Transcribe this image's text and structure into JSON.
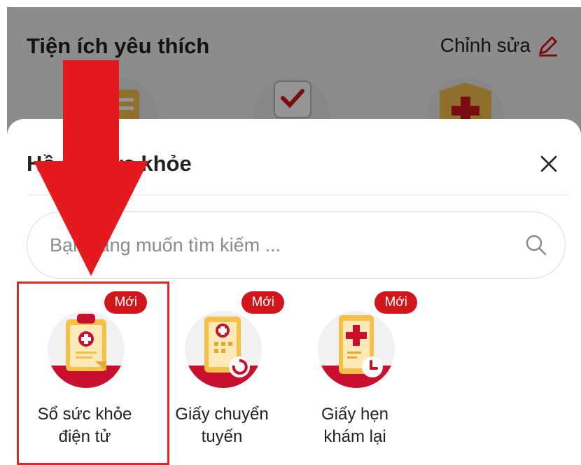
{
  "background": {
    "title": "Tiện ích yêu thích",
    "edit_label": "Chỉnh sửa",
    "edit_icon": "pencil-icon"
  },
  "sheet": {
    "title": "Hồ sơ sức khỏe",
    "close_icon": "close-icon",
    "search": {
      "placeholder": "Bạn đang muốn tìm kiếm ...",
      "value": "",
      "icon": "search-icon"
    },
    "items": [
      {
        "line1": "Sổ sức khỏe",
        "line2": "điện tử",
        "badge": "Mới",
        "icon": "health-record-clipboard-icon",
        "highlighted": true
      },
      {
        "line1": "Giấy chuyển",
        "line2": "tuyến",
        "badge": "Mới",
        "icon": "referral-paper-icon",
        "highlighted": false
      },
      {
        "line1": "Giấy hẹn",
        "line2": "khám lại",
        "badge": "Mới",
        "icon": "appointment-paper-icon",
        "highlighted": false
      }
    ]
  },
  "colors": {
    "accent": "#d0161a",
    "arrow": "#e3191e",
    "highlight_border": "#d42a2a",
    "icon_gold": "#f5c04a"
  }
}
